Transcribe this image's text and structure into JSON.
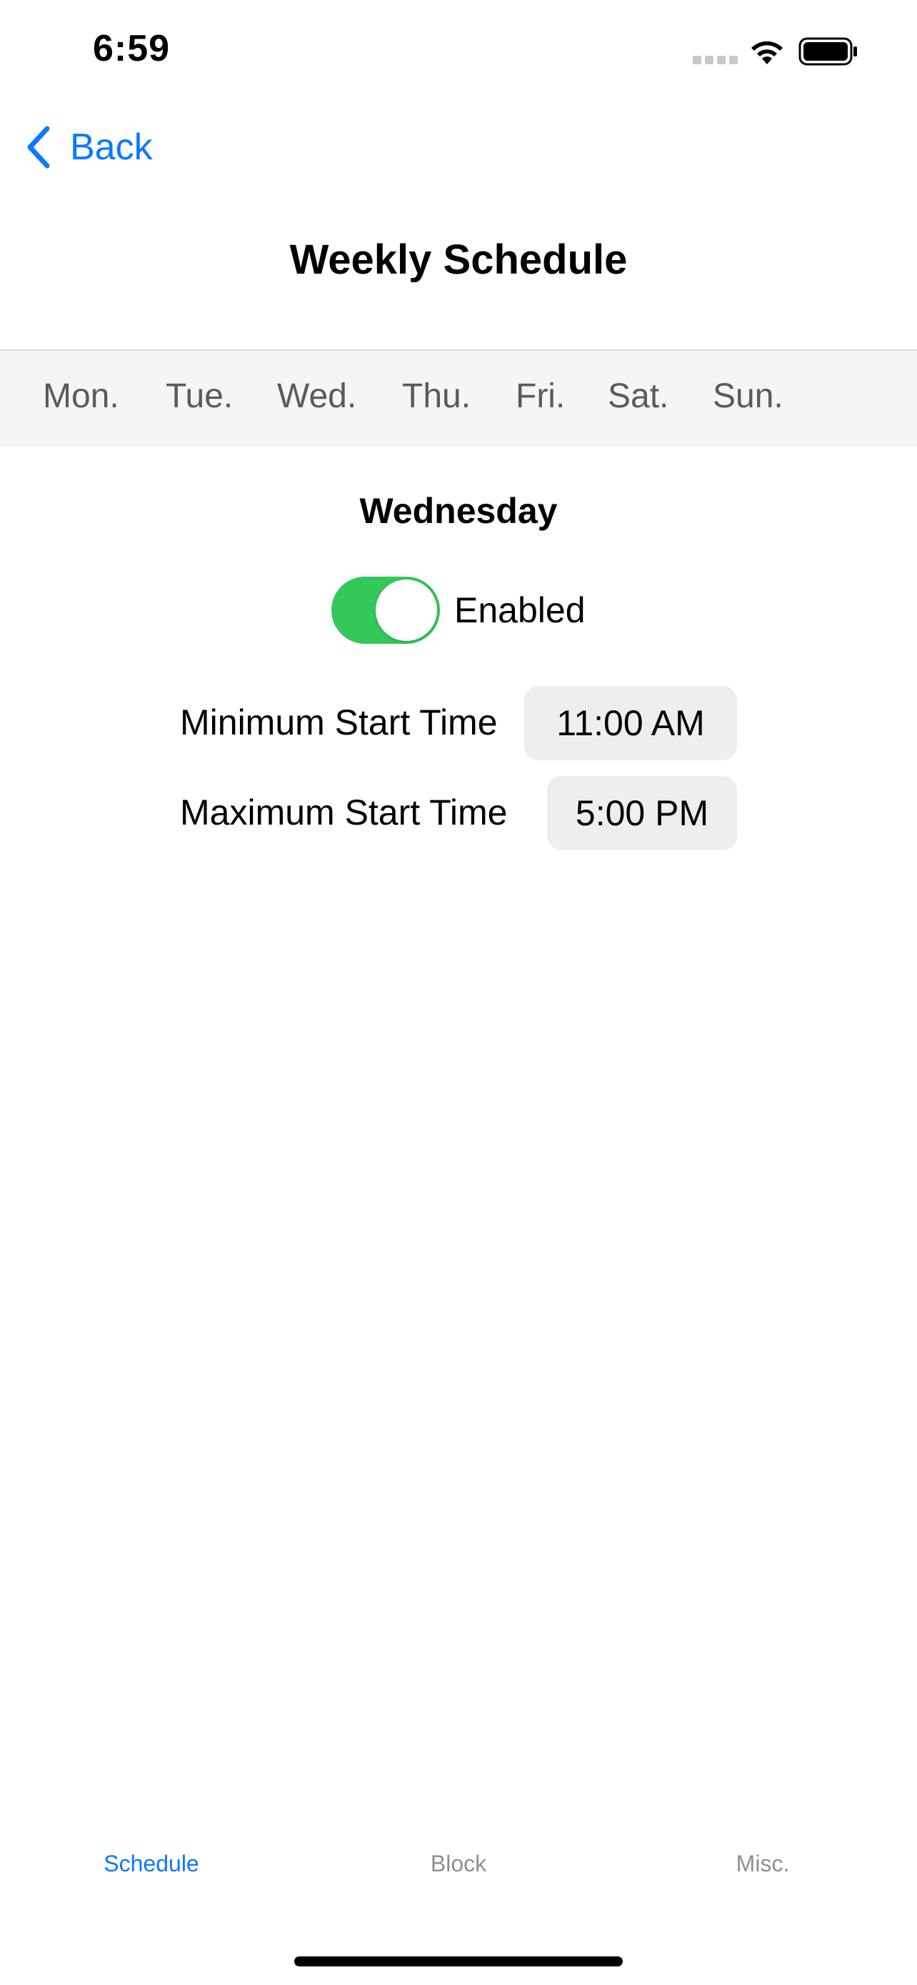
{
  "status_bar": {
    "time": "6:59"
  },
  "nav": {
    "back_label": "Back",
    "title": "Weekly Schedule"
  },
  "days": {
    "mon": "Mon.",
    "tue": "Tue.",
    "wed": "Wed.",
    "thu": "Thu.",
    "fri": "Fri.",
    "sat": "Sat.",
    "sun": "Sun.",
    "selected": "Wed."
  },
  "content": {
    "day_heading": "Wednesday",
    "enabled_label": "Enabled",
    "enabled": true,
    "min_label": "Minimum Start Time",
    "min_value": "11:00 AM",
    "max_label": "Maximum Start Time",
    "max_value": "5:00 PM"
  },
  "tab_bar": {
    "schedule": "Schedule",
    "block": "Block",
    "misc": "Misc.",
    "active": "Schedule"
  },
  "colors": {
    "accent": "#0a7aff",
    "toggle_on": "#34c759",
    "inactive_tab": "#8e8e93",
    "day_bar_bg": "#f5f5f5"
  }
}
